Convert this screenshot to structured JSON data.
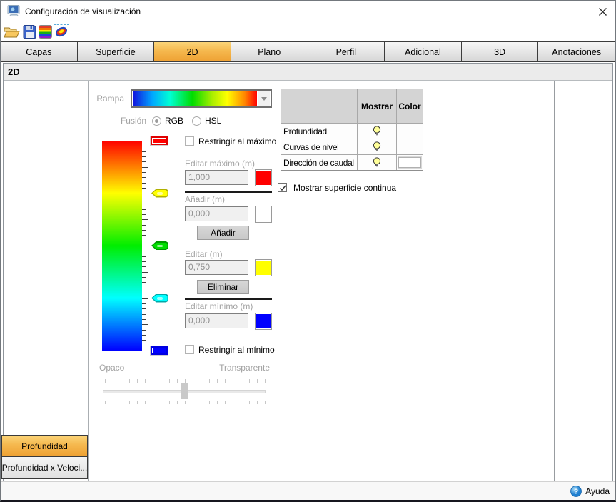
{
  "window": {
    "title": "Configuración de visualización"
  },
  "toolbar": {
    "icons": [
      "open-file",
      "save",
      "color-ramp",
      "contour-colors"
    ]
  },
  "tabs": {
    "items": [
      "Capas",
      "Superficie",
      "2D",
      "Plano",
      "Perfil",
      "Adicional",
      "3D",
      "Anotaciones"
    ],
    "selected": "2D"
  },
  "section": {
    "title": "2D"
  },
  "ramp_panel": {
    "ramp_label": "Rampa",
    "fusion_label": "Fusión",
    "fusion_options": [
      {
        "label": "RGB",
        "selected": true
      },
      {
        "label": "HSL",
        "selected": false
      }
    ],
    "restrict_max_label": "Restringir al máximo",
    "restrict_min_label": "Restringir al mínimo",
    "edit_max_label": "Editar máximo (m)",
    "edit_max_value": "1,000",
    "edit_max_color": "#ff0000",
    "add_label": "Añadir (m)",
    "add_value": "0,000",
    "add_color": "#ffffff",
    "add_button": "Añadir",
    "edit_label": "Editar (m)",
    "edit_value": "0,750",
    "edit_color": "#ffff00",
    "delete_button": "Eliminar",
    "edit_min_label": "Editar mínimo (m)",
    "edit_min_value": "0,000",
    "edit_min_color": "#0000ff",
    "opacity_left": "Opaco",
    "opacity_right": "Transparente",
    "handles": [
      {
        "type": "end",
        "fill": "#ff0000",
        "border": "#e00000",
        "pos": 0
      },
      {
        "type": "mid",
        "fill": "#ffff00",
        "border": "#b0b000",
        "pos": 0.25
      },
      {
        "type": "mid",
        "fill": "#00dd00",
        "border": "#009800",
        "pos": 0.5
      },
      {
        "type": "mid",
        "fill": "#00ffff",
        "border": "#00a8a8",
        "pos": 0.75
      },
      {
        "type": "end",
        "fill": "#0000ff",
        "border": "#0000e0",
        "pos": 1
      }
    ]
  },
  "layer_table": {
    "columns": [
      "",
      "Mostrar",
      "Color"
    ],
    "rows": [
      {
        "label": "Profundidad",
        "show": true,
        "color": null
      },
      {
        "label": "Curvas de nivel",
        "show": true,
        "color": null
      },
      {
        "label": "Dirección de caudal",
        "show": true,
        "color": "#ffffff"
      }
    ]
  },
  "surface_checkbox": {
    "label": "Mostrar superficie continua",
    "checked": true
  },
  "bottom_tabs": {
    "items": [
      "Profundidad",
      "Profundidad x Veloci..."
    ],
    "selected": "Profundidad"
  },
  "footer": {
    "help_label": "Ayuda"
  }
}
